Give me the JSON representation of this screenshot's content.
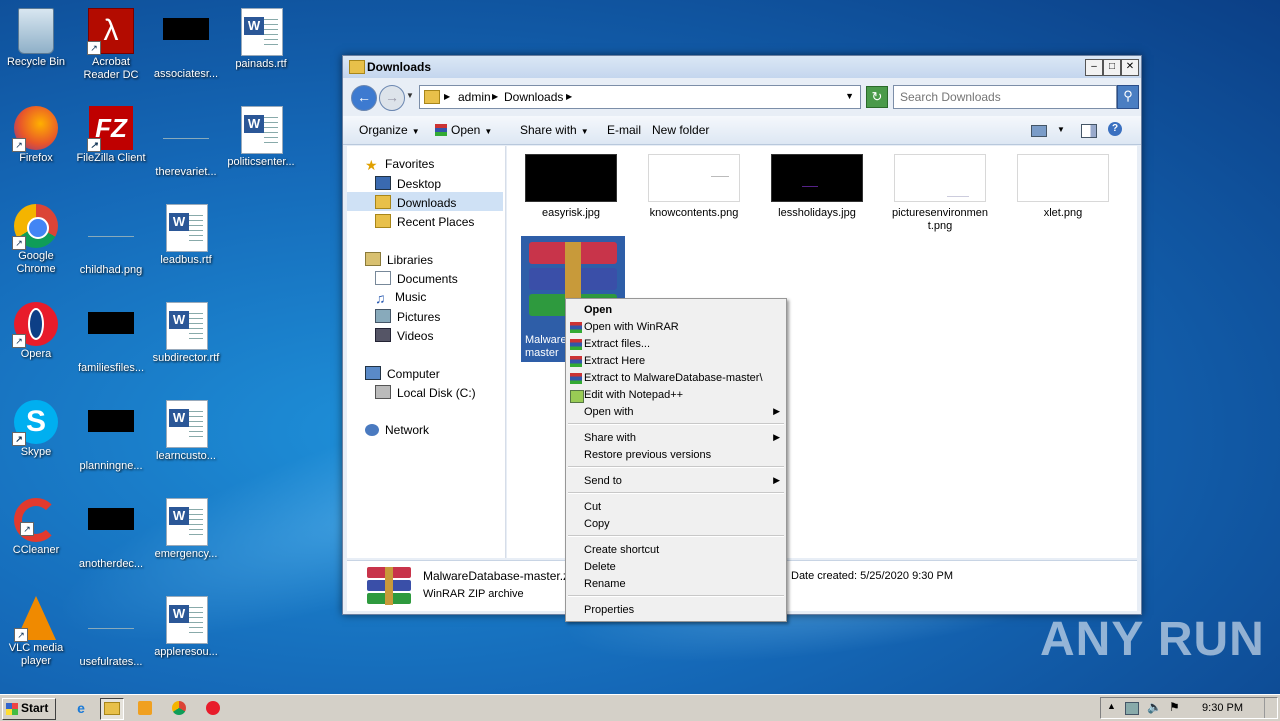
{
  "desktop": {
    "icons": [
      {
        "label": "Recycle Bin"
      },
      {
        "label": "Acrobat Reader DC"
      },
      {
        "label": "associatesr..."
      },
      {
        "label": "painads.rtf"
      },
      {
        "label": "Firefox"
      },
      {
        "label": "FileZilla Client"
      },
      {
        "label": "therevariet..."
      },
      {
        "label": "politicsenter..."
      },
      {
        "label": "Google Chrome"
      },
      {
        "label": "childhad.png"
      },
      {
        "label": "leadbus.rtf"
      },
      {
        "label": "Opera"
      },
      {
        "label": "familiesfiles..."
      },
      {
        "label": "subdirector.rtf"
      },
      {
        "label": "Skype"
      },
      {
        "label": "planningne..."
      },
      {
        "label": "learncusto..."
      },
      {
        "label": "CCleaner"
      },
      {
        "label": "anotherdec..."
      },
      {
        "label": "emergency..."
      },
      {
        "label": "VLC media player"
      },
      {
        "label": "usefulrates..."
      },
      {
        "label": "appleresou..."
      }
    ]
  },
  "window": {
    "title": "Downloads",
    "breadcrumbs": [
      "admin",
      "Downloads"
    ],
    "search_placeholder": "Search Downloads",
    "toolbar": {
      "organize": "Organize",
      "open": "Open",
      "share_with": "Share with",
      "email": "E-mail",
      "new_folder": "New folder"
    },
    "nav": {
      "favorites": "Favorites",
      "desktop": "Desktop",
      "downloads": "Downloads",
      "recent_places": "Recent Places",
      "libraries": "Libraries",
      "documents": "Documents",
      "music": "Music",
      "pictures": "Pictures",
      "videos": "Videos",
      "computer": "Computer",
      "local_disk": "Local Disk (C:)",
      "network": "Network"
    },
    "files": [
      {
        "name": "easyrisk.jpg"
      },
      {
        "name": "knowcontents.png"
      },
      {
        "name": "lessholidays.jpg"
      },
      {
        "name": "picturesenvironment.png"
      },
      {
        "name": "xlet.png"
      },
      {
        "name": "MalwareDatabase-master"
      }
    ],
    "details": {
      "filename": "MalwareDatabase-master.zip",
      "filetype": "WinRAR ZIP archive",
      "date_created": "Date created: 5/25/2020 9:30 PM"
    }
  },
  "context_menu": {
    "items": [
      "Open",
      "Open with WinRAR",
      "Extract files...",
      "Extract Here",
      "Extract to MalwareDatabase-master\\",
      "Edit with Notepad++",
      "Open with",
      "Share with",
      "Restore previous versions",
      "Send to",
      "Cut",
      "Copy",
      "Create shortcut",
      "Delete",
      "Rename",
      "Properties"
    ]
  },
  "taskbar": {
    "start": "Start",
    "clock": "9:30 PM"
  },
  "watermark": "ANY RUN"
}
